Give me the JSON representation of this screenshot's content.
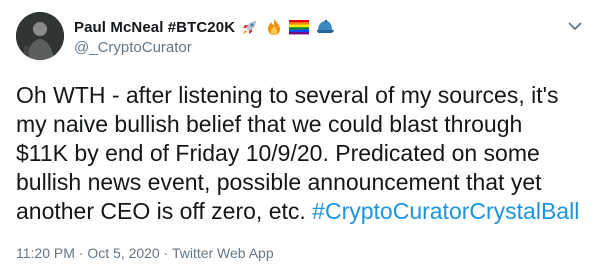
{
  "user": {
    "display_name": "Paul McNeal #BTC20K",
    "handle": "@_CryptoCurator",
    "name_emojis": [
      "rocket-icon",
      "fire-icon",
      "rainbow-flag-icon",
      "blue-cap-icon"
    ]
  },
  "tweet": {
    "text_lines": [
      "Oh WTH - after listening to several of my sources, it's",
      "my naive bullish belief that we could blast through",
      "$11K by end of Friday 10/9/20. Predicated on some",
      "bullish news event, possible announcement that yet",
      "another CEO is off zero, etc. "
    ],
    "hashtag": "#CryptoCuratorCrystalBall"
  },
  "meta": {
    "time": "11:20 PM",
    "separator": " · ",
    "date": "Oct 5, 2020",
    "source": "Twitter Web App"
  },
  "colors": {
    "link": "#1b95e0",
    "secondary_text": "#657786",
    "primary_text": "#14171a"
  }
}
